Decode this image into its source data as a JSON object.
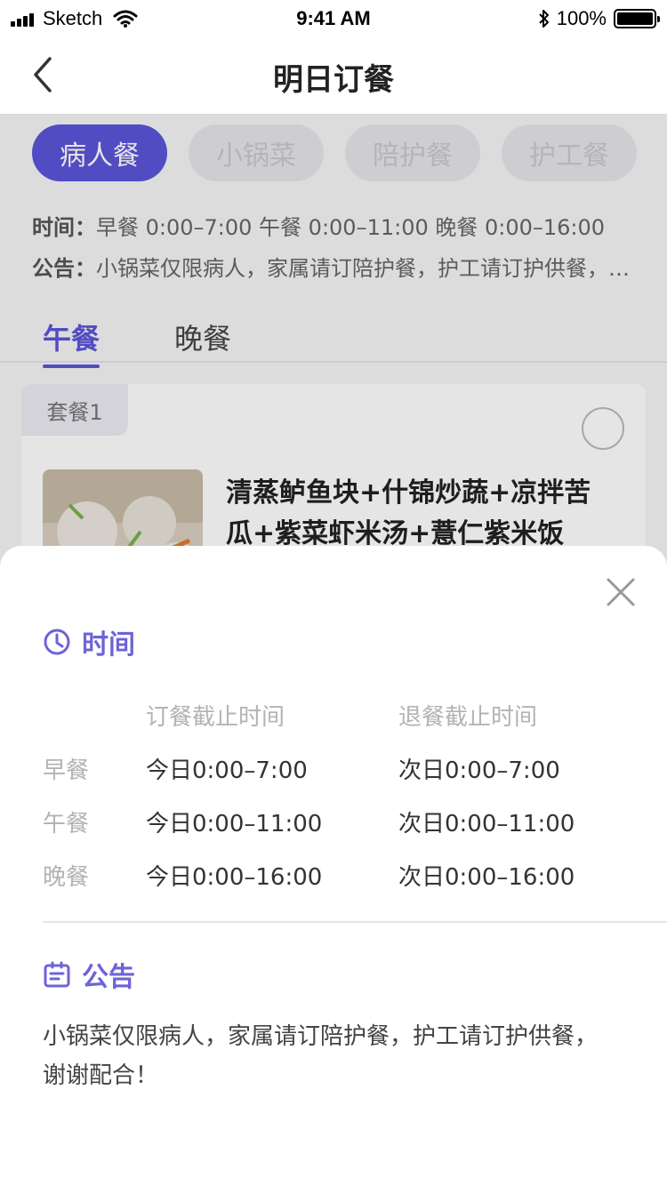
{
  "status_bar": {
    "carrier": "Sketch",
    "time": "9:41 AM",
    "battery": "100%"
  },
  "nav": {
    "title": "明日订餐"
  },
  "meal_types": [
    {
      "label": "病人餐",
      "active": true
    },
    {
      "label": "小锅菜",
      "active": false
    },
    {
      "label": "陪护餐",
      "active": false
    },
    {
      "label": "护工餐",
      "active": false
    }
  ],
  "info": {
    "time_label": "时间：",
    "time_text": "早餐 0:00–7:00 午餐 0:00–11:00 晚餐 0:00–16:00",
    "notice_label": "公告：",
    "notice_text": "小锅菜仅限病人，家属请订陪护餐，护工请订护供餐，谢谢配合！"
  },
  "tabs": [
    {
      "label": "午餐",
      "active": true
    },
    {
      "label": "晚餐",
      "active": false
    }
  ],
  "card": {
    "tag": "套餐1",
    "name": "清蒸鲈鱼块+什锦炒蔬+凉拌苦瓜+紫菜虾米汤+薏仁紫米饭"
  },
  "sheet": {
    "time_title": "时间",
    "order_header": "订餐截止时间",
    "cancel_header": "退餐截止时间",
    "rows": [
      {
        "meal": "早餐",
        "order": "今日0:00–7:00",
        "cancel": "次日0:00–7:00"
      },
      {
        "meal": "午餐",
        "order": "今日0:00–11:00",
        "cancel": "次日0:00–11:00"
      },
      {
        "meal": "晚餐",
        "order": "今日0:00–16:00",
        "cancel": "次日0:00–16:00"
      }
    ],
    "notice_title": "公告",
    "notice_text": "小锅菜仅限病人，家属请订陪护餐，护工请订护供餐，谢谢配合！"
  },
  "colors": {
    "accent": "#5b55d9",
    "accent_light": "#6e63d8"
  }
}
